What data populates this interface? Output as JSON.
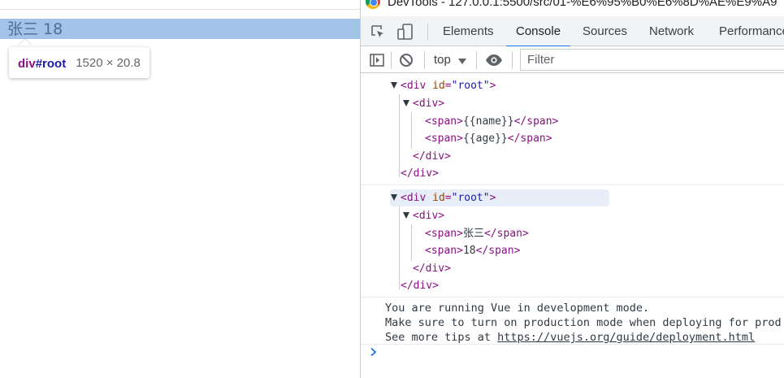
{
  "page": {
    "root_text": "张三 18",
    "tooltip": {
      "tag": "div",
      "id": "#root",
      "size": "1520 × 20.8"
    }
  },
  "devtools": {
    "title": "DevTools - 127.0.0.1:5500/src/01-%E6%95%B0%E6%8D%AE%E9%A9",
    "toolbar_icons": [
      "inspect-element-icon",
      "device-toolbar-icon"
    ],
    "tabs": [
      {
        "label": "Elements",
        "active": false
      },
      {
        "label": "Console",
        "active": true
      },
      {
        "label": "Sources",
        "active": false
      },
      {
        "label": "Network",
        "active": false
      },
      {
        "label": "Performance",
        "active": false
      }
    ],
    "accent_color": "#1a73e8",
    "console_toolbar": {
      "icons": [
        "sidebar-toggle-icon",
        "clear-console-icon",
        "eye-icon"
      ],
      "context": "top",
      "filter_placeholder": "Filter"
    },
    "console": {
      "tree1": {
        "root_open": "<div",
        "root_attr": "id",
        "root_value": "\"root\"",
        "root_gt": ">",
        "div_open": "<div>",
        "span1_open": "<span>",
        "span1_text": "{{name}}",
        "span1_close": "</span>",
        "span2_open": "<span>",
        "span2_text": "{{age}}",
        "span2_close": "</span>",
        "div_close": "</div>",
        "root_close": "</div>"
      },
      "tree2": {
        "root_open": "<div",
        "root_attr": "id",
        "root_value": "\"root\"",
        "root_gt": ">",
        "div_open": "<div>",
        "span1_open": "<span>",
        "span1_text": "张三",
        "span1_close": "</span>",
        "span2_open": "<span>",
        "span2_text": "18",
        "span2_close": "</span>",
        "div_close": "</div>",
        "root_close": "</div>"
      },
      "vue_message": {
        "line1": "You are running Vue in development mode.",
        "line2": "Make sure to turn on production mode when deploying for prod",
        "line3_prefix": "See more tips at ",
        "link": "https://vuejs.org/guide/deployment.html"
      },
      "prompt_icon": "chevron-right-icon"
    }
  }
}
